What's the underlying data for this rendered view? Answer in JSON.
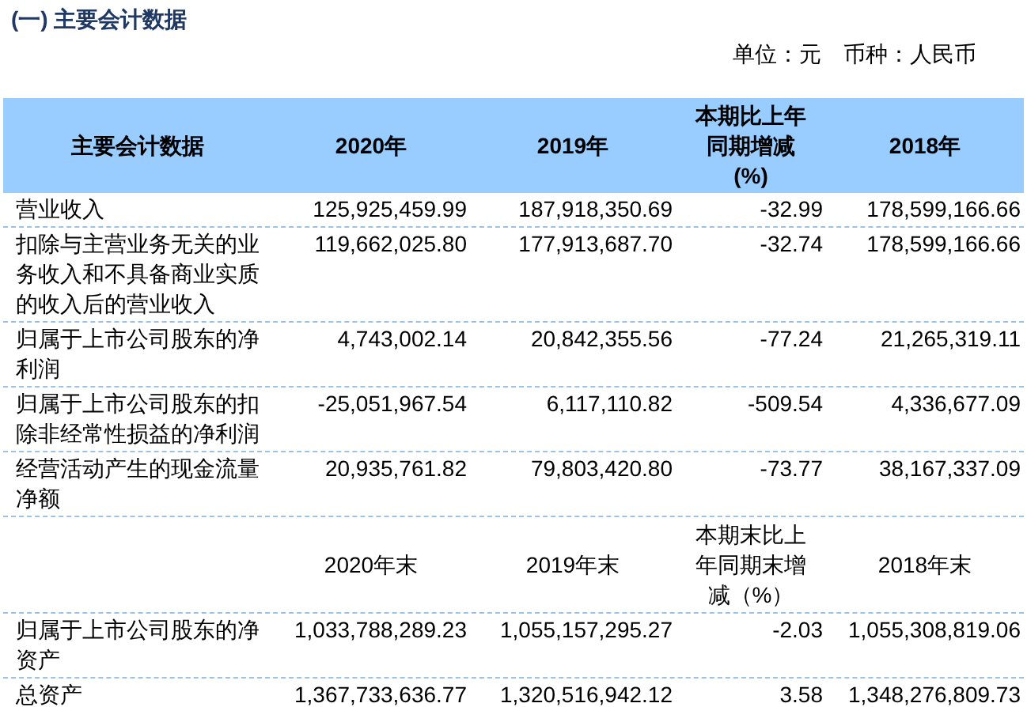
{
  "section_title": "(一) 主要会计数据",
  "unit_note": "单位：元　币种：人民币",
  "table": {
    "header": [
      "主要会计数据",
      "2020年",
      "2019年",
      "本期比上年同期增减(%)",
      "2018年"
    ],
    "rows": [
      {
        "label": "营业收入",
        "values": [
          "125,925,459.99",
          "187,918,350.69",
          "-32.99",
          "178,599,166.66"
        ]
      },
      {
        "label": "扣除与主营业务无关的业务收入和不具备商业实质的收入后的营业收入",
        "values": [
          "119,662,025.80",
          "177,913,687.70",
          "-32.74",
          "178,599,166.66"
        ]
      },
      {
        "label": "归属于上市公司股东的净利润",
        "values": [
          "4,743,002.14",
          "20,842,355.56",
          "-77.24",
          "21,265,319.11"
        ]
      },
      {
        "label": "归属于上市公司股东的扣除非经常性损益的净利润",
        "values": [
          "-25,051,967.54",
          "6,117,110.82",
          "-509.54",
          "4,336,677.09"
        ]
      },
      {
        "label": "经营活动产生的现金流量净额",
        "values": [
          "20,935,761.82",
          "79,803,420.80",
          "-73.77",
          "38,167,337.09"
        ]
      }
    ],
    "subheader": [
      "2020年末",
      "2019年末",
      "本期末比上年同期末增减（%）",
      "2018年末"
    ],
    "rows_2": [
      {
        "label": "归属于上市公司股东的净资产",
        "values": [
          "1,033,788,289.23",
          "1,055,157,295.27",
          "-2.03",
          "1,055,308,819.06"
        ]
      },
      {
        "label": "总资产",
        "values": [
          "1,367,733,636.77",
          "1,320,516,942.12",
          "3.58",
          "1,348,276,809.73"
        ]
      }
    ]
  }
}
